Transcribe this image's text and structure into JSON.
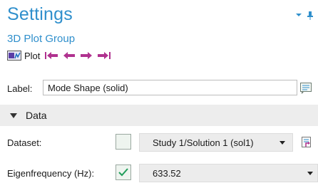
{
  "header": {
    "title": "Settings",
    "subtitle": "3D Plot Group"
  },
  "toolbar": {
    "plot_label": "Plot"
  },
  "label_row": {
    "label": "Label:",
    "value": "Mode Shape (solid)"
  },
  "data_section": {
    "title": "Data",
    "dataset": {
      "label": "Dataset:",
      "checked": false,
      "selected": "Study 1/Solution 1 (sol1)"
    },
    "eigenfrequency": {
      "label": "Eigenfrequency (Hz):",
      "checked": true,
      "selected": "633.52"
    }
  },
  "colors": {
    "accent": "#2f8fcc",
    "nav_arrows": "#b0328f",
    "check_green": "#1f9d5a",
    "section_bg": "#ededed"
  }
}
